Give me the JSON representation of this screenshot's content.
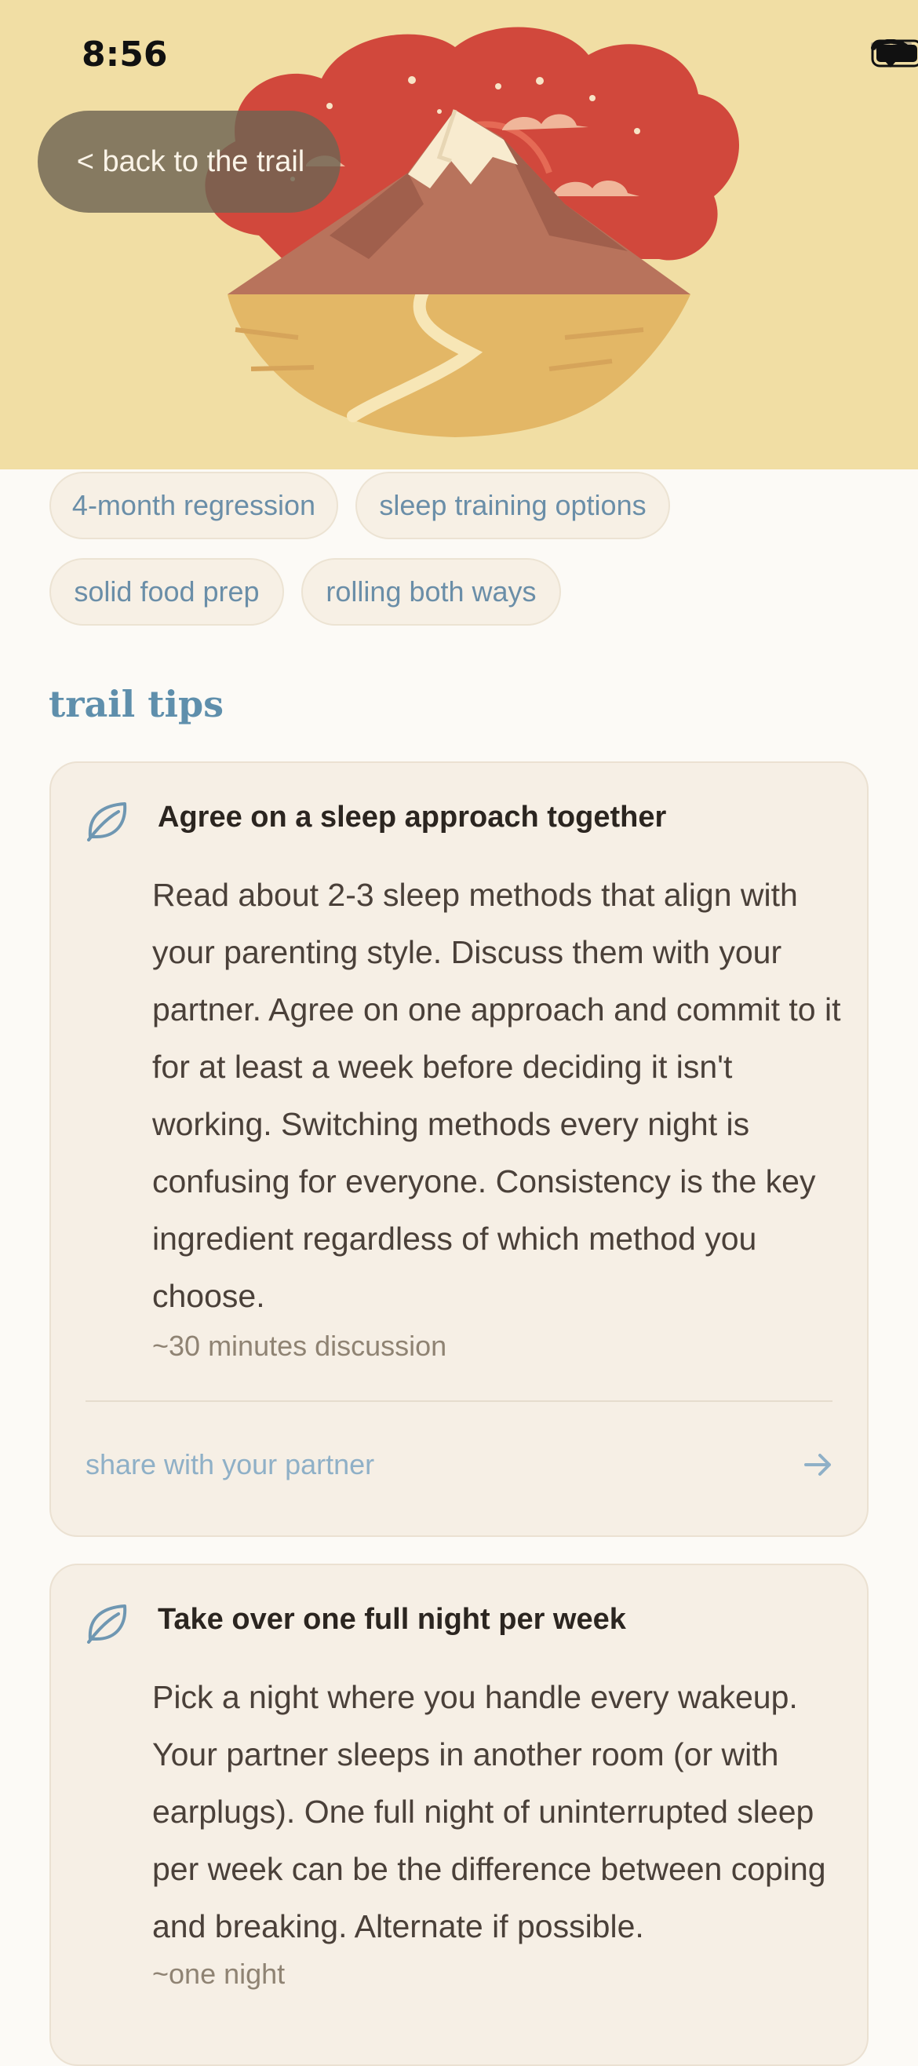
{
  "status": {
    "time": "8:56"
  },
  "hero": {
    "back_label": "< back to the trail"
  },
  "chips": [
    "4-month regression",
    "sleep training options",
    "solid food prep",
    "rolling both ways"
  ],
  "section": {
    "title": "trail tips"
  },
  "tips": [
    {
      "title": "Agree on a sleep approach together",
      "body": "Read about 2-3 sleep methods that align with your parenting style. Discuss them with your partner. Agree on one approach and commit to it for at least a week before deciding it isn't working. Switching methods every night is confusing for everyone. Consistency is the key ingredient regardless of which method you choose.",
      "meta": "~30 minutes discussion",
      "action": "share with your partner"
    },
    {
      "title": "Take over one full night per week",
      "body": "Pick a night where you handle every wakeup. Your partner sleeps in another room (or with earplugs). One full night of uninterrupted sleep per week can be the difference between coping and breaking. Alternate if possible.",
      "meta": "~one night"
    }
  ],
  "icons": {
    "leaf": "leaf-icon",
    "arrow": "arrow-right-icon",
    "signal": "cellular-signal-icon",
    "wifi": "wifi-icon",
    "battery": "battery-icon"
  },
  "colors": {
    "accent": "#5f8fac",
    "hero_bg": "#f1dea4",
    "card_bg": "#f6efe5",
    "page_bg": "#fcfaf6"
  }
}
